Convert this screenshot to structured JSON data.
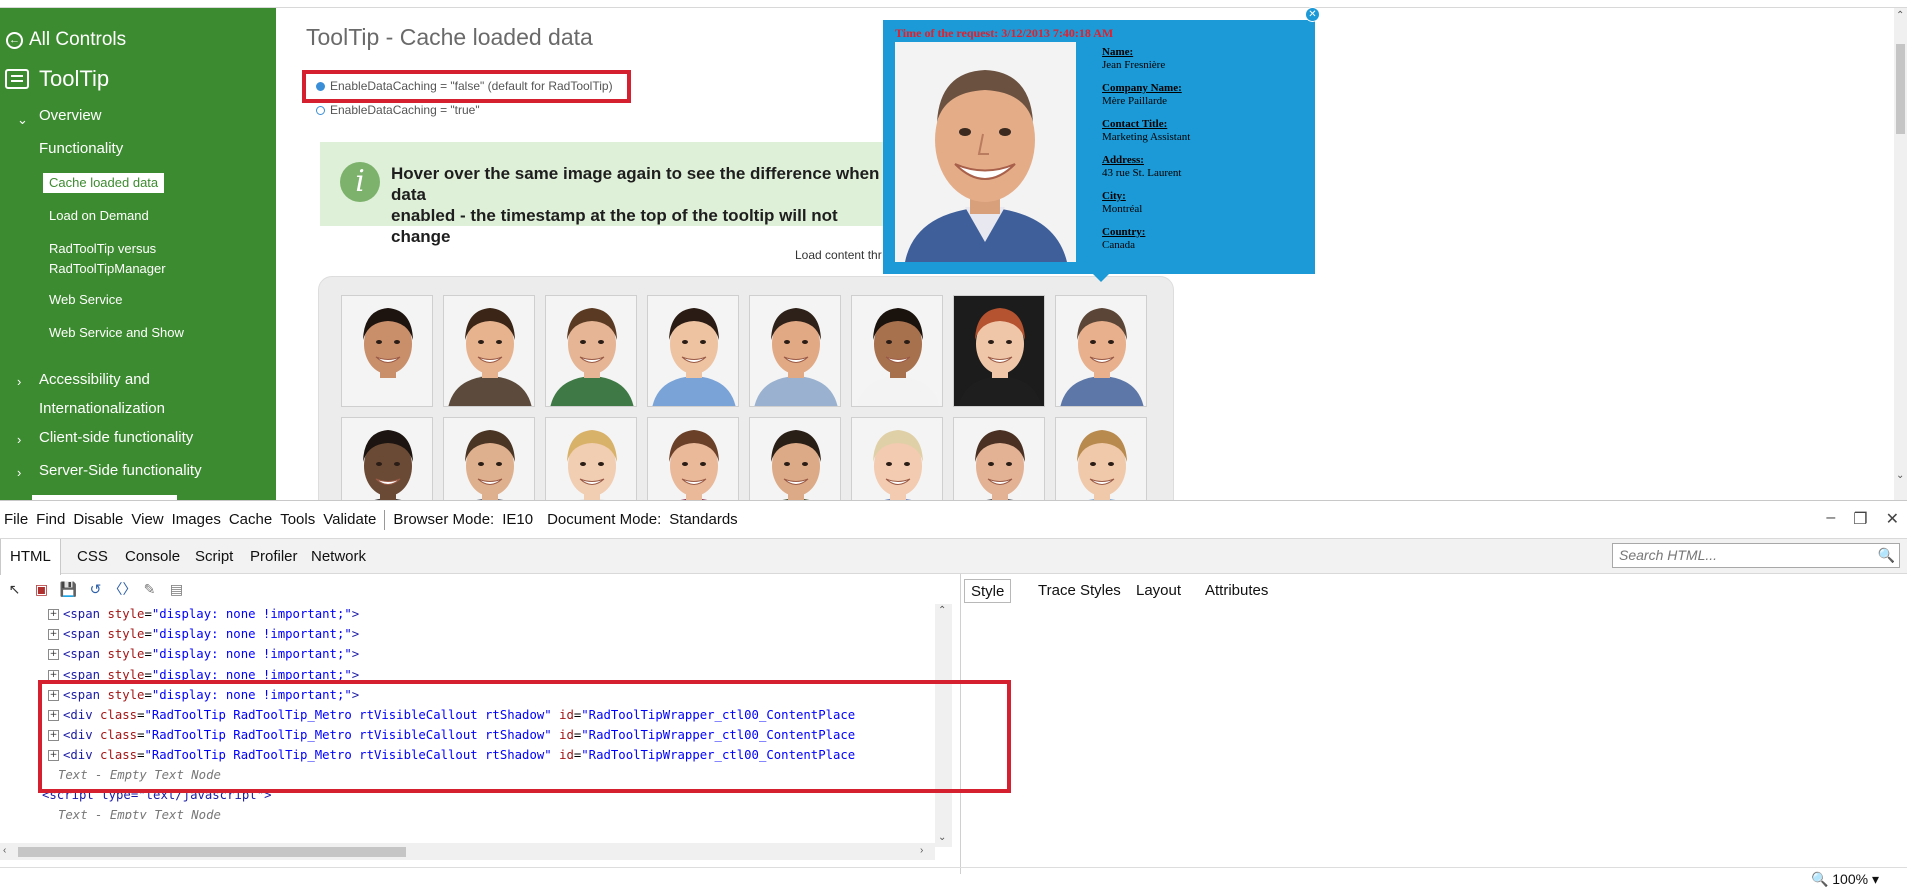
{
  "sidebar": {
    "all_controls": "All Controls",
    "section_title": "ToolTip",
    "items": [
      {
        "label": "Overview"
      },
      {
        "label": "Functionality"
      },
      {
        "label": "Accessibility and"
      },
      {
        "label": "Internationalization"
      },
      {
        "label": "Client-side functionality"
      },
      {
        "label": "Server-Side functionality"
      }
    ],
    "sub_items": [
      {
        "label": "Cache loaded data"
      },
      {
        "label": "Load on Demand"
      },
      {
        "label": "RadToolTip versus"
      },
      {
        "label": "RadToolTipManager"
      },
      {
        "label": "Web Service"
      },
      {
        "label": "Web Service and Show"
      }
    ]
  },
  "content": {
    "title": "ToolTip - Cache loaded data",
    "radio_false": "EnableDataCaching = \"false\" (default for RadToolTip)",
    "radio_true": "EnableDataCaching = \"true\"",
    "info_line1": "Hover over the same image again to see the difference when data",
    "info_line2": "enabled - the timestamp at the top of the tooltip will not change",
    "load_text": "Load content thr"
  },
  "tooltip": {
    "time": "Time of the request: 3/12/2013 7:40:18 AM",
    "fields": [
      {
        "label": "Name:",
        "value": "Jean Fresnière"
      },
      {
        "label": "Company Name:",
        "value": "Mère Paillarde"
      },
      {
        "label": "Contact Title:",
        "value": "Marketing Assistant"
      },
      {
        "label": "Address:",
        "value": "43 rue St. Laurent"
      },
      {
        "label": "City:",
        "value": "Montréal"
      },
      {
        "label": "Country:",
        "value": "Canada"
      }
    ]
  },
  "devtools": {
    "menu": [
      {
        "label": "File"
      },
      {
        "label": "Find"
      },
      {
        "label": "Disable"
      },
      {
        "label": "View"
      },
      {
        "label": "Images"
      },
      {
        "label": "Cache"
      },
      {
        "label": "Tools"
      },
      {
        "label": "Validate"
      }
    ],
    "browser_mode": "Browser Mode:",
    "browser_mode_value": "IE10",
    "document_mode": "Document Mode:",
    "document_mode_value": "Standards",
    "tabs": [
      {
        "label": "HTML"
      },
      {
        "label": "CSS"
      },
      {
        "label": "Console"
      },
      {
        "label": "Script"
      },
      {
        "label": "Profiler"
      },
      {
        "label": "Network"
      }
    ],
    "search_placeholder": "Search HTML...",
    "right_tabs": [
      {
        "label": "Style"
      },
      {
        "label": "Trace Styles"
      },
      {
        "label": "Layout"
      },
      {
        "label": "Attributes"
      }
    ],
    "tree": {
      "span_tag": "<span",
      "span_attr": "style",
      "span_val": "\"display: none !important;\"",
      "span_close": ">",
      "div_tag": "<div",
      "div_class_attr": "class",
      "div_class_val": "\"RadToolTip RadToolTip_Metro rtVisibleCallout rtShadow\"",
      "div_id_attr": "id",
      "div_id_val": "\"RadToolTipWrapper_ctl00_ContentPlace",
      "empty_node": "Text - Empty Text Node",
      "script_line": "<script type=\"text/javascript\">"
    },
    "zoom": "100%"
  },
  "colors": {
    "sidebar_green": "#3d8b30",
    "tooltip_blue": "#1b9ad7",
    "highlight_red": "#d4202f",
    "info_green_bg": "#dff0d8"
  }
}
